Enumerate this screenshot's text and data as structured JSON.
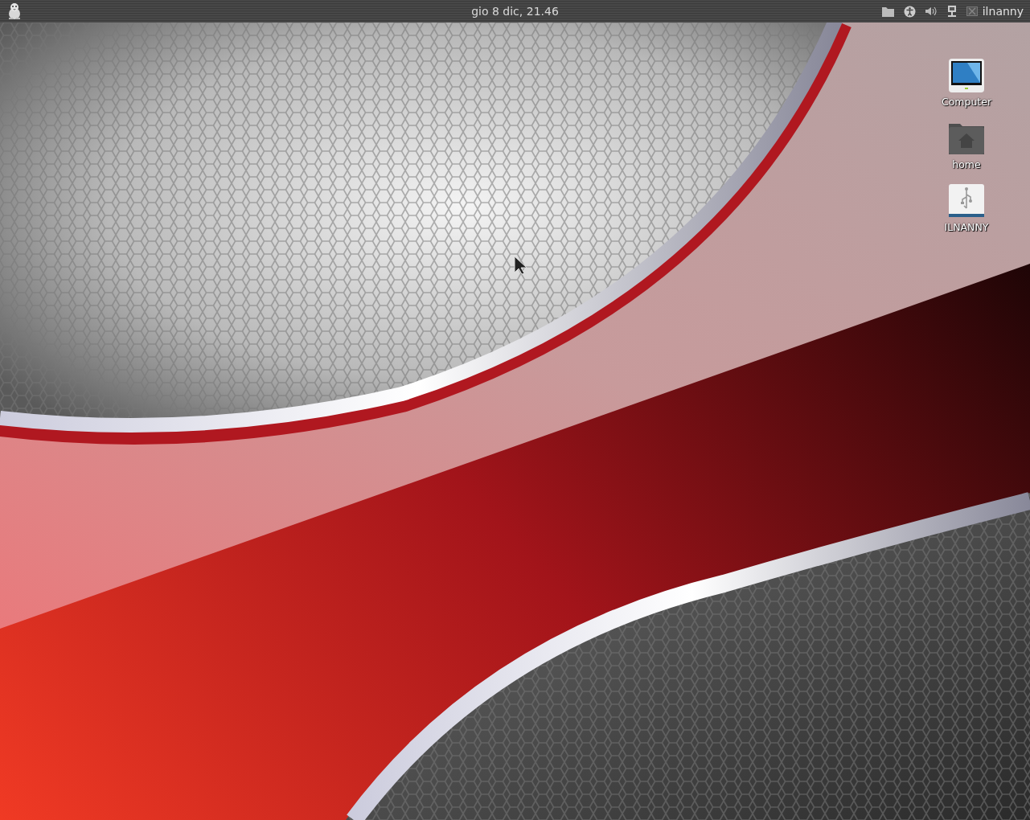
{
  "top_panel": {
    "clock": "gio  8 dic, 21.46",
    "user": "ilnanny"
  },
  "desktop_icons": [
    {
      "kind": "computer",
      "label": "Computer"
    },
    {
      "kind": "home",
      "label": "home"
    },
    {
      "kind": "usb",
      "label": "ILNANNY"
    }
  ]
}
